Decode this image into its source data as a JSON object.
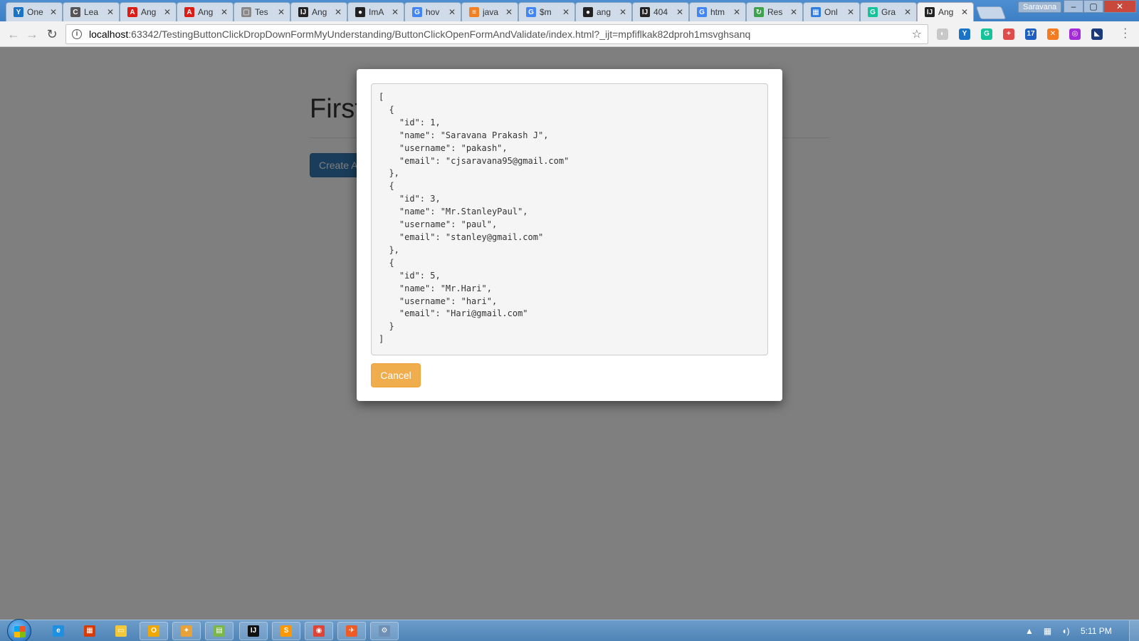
{
  "browser": {
    "tabs": [
      {
        "title": "One",
        "icon": "y-icon",
        "color": "#1a73c7",
        "glyph": "Y"
      },
      {
        "title": "Lea",
        "icon": "code-icon",
        "color": "#555555",
        "glyph": "C"
      },
      {
        "title": "Ang",
        "icon": "angular-icon",
        "color": "#dd1b16",
        "glyph": "A"
      },
      {
        "title": "Ang",
        "icon": "angular-icon",
        "color": "#dd1b16",
        "glyph": "A"
      },
      {
        "title": "Tes",
        "icon": "page-icon",
        "color": "#888888",
        "glyph": "▢"
      },
      {
        "title": "Ang",
        "icon": "intellij-icon",
        "color": "#222222",
        "glyph": "IJ"
      },
      {
        "title": "ImA",
        "icon": "github-icon",
        "color": "#222222",
        "glyph": "●"
      },
      {
        "title": "hov",
        "icon": "google-icon",
        "color": "#4285f4",
        "glyph": "G"
      },
      {
        "title": "java",
        "icon": "stackoverflow-icon",
        "color": "#f48024",
        "glyph": "≡"
      },
      {
        "title": "$m",
        "icon": "google-icon",
        "color": "#4285f4",
        "glyph": "G"
      },
      {
        "title": "ang",
        "icon": "github-icon",
        "color": "#222222",
        "glyph": "●"
      },
      {
        "title": "404",
        "icon": "intellij-icon",
        "color": "#222222",
        "glyph": "IJ"
      },
      {
        "title": "htm",
        "icon": "google-icon",
        "color": "#4285f4",
        "glyph": "G"
      },
      {
        "title": "Res",
        "icon": "refresh-icon",
        "color": "#3fa34d",
        "glyph": "↻"
      },
      {
        "title": "Onl",
        "icon": "grid-icon",
        "color": "#2f7de1",
        "glyph": "▦"
      },
      {
        "title": "Gra",
        "icon": "grammarly-icon",
        "color": "#15c39a",
        "glyph": "G"
      },
      {
        "title": "Ang",
        "icon": "intellij-icon",
        "color": "#222222",
        "glyph": "IJ",
        "active": true
      }
    ],
    "user_badge": "Saravana",
    "url_host": "localhost",
    "url_rest": ":63342/TestingButtonClickDropDownFormMyUnderstanding/ButtonClickOpenFormAndValidate/index.html?_ijt=mpfiflkak82dproh1msvghsanq",
    "extensions": [
      {
        "icon": "opera-icon",
        "color": "#c8c8c8",
        "glyph": "◐"
      },
      {
        "icon": "y-icon",
        "color": "#1a73c7",
        "glyph": "Y"
      },
      {
        "icon": "grammarly-icon",
        "color": "#15c39a",
        "glyph": "G"
      },
      {
        "icon": "plus-icon",
        "color": "#e04b4b",
        "glyph": "+"
      },
      {
        "icon": "cloud-icon",
        "color": "#1f5fbf",
        "glyph": "17"
      },
      {
        "icon": "orange-x-icon",
        "color": "#f47b20",
        "glyph": "✕"
      },
      {
        "icon": "purple-globe-icon",
        "color": "#a32bd8",
        "glyph": "◎"
      },
      {
        "icon": "bookmark-icon",
        "color": "#1a3a7a",
        "glyph": "◣"
      }
    ]
  },
  "page": {
    "heading": "First",
    "create_button": "Create A",
    "modal": {
      "json_text": "[\n  {\n    \"id\": 1,\n    \"name\": \"Saravana Prakash J\",\n    \"username\": \"pakash\",\n    \"email\": \"cjsaravana95@gmail.com\"\n  },\n  {\n    \"id\": 3,\n    \"name\": \"Mr.StanleyPaul\",\n    \"username\": \"paul\",\n    \"email\": \"stanley@gmail.com\"\n  },\n  {\n    \"id\": 5,\n    \"name\": \"Mr.Hari\",\n    \"username\": \"hari\",\n    \"email\": \"Hari@gmail.com\"\n  }\n]",
      "cancel_label": "Cancel"
    }
  },
  "taskbar": {
    "clock": "5:11 PM",
    "items": [
      {
        "icon": "ie-icon",
        "color": "#1f8fe0",
        "glyph": "e"
      },
      {
        "icon": "office-icon",
        "color": "#d83b01",
        "glyph": "▦"
      },
      {
        "icon": "explorer-icon",
        "color": "#f3c83a",
        "glyph": "▭"
      },
      {
        "icon": "outlook-icon",
        "color": "#f0a800",
        "glyph": "O"
      },
      {
        "icon": "paint-icon",
        "color": "#e8a23a",
        "glyph": "✦"
      },
      {
        "icon": "folders-icon",
        "color": "#7ab648",
        "glyph": "▤"
      },
      {
        "icon": "intellij-icon",
        "color": "#111111",
        "glyph": "IJ"
      },
      {
        "icon": "sublime-icon",
        "color": "#ff9800",
        "glyph": "S"
      },
      {
        "icon": "chrome-icon",
        "color": "#db4437",
        "glyph": "◉"
      },
      {
        "icon": "postman-icon",
        "color": "#ef5b25",
        "glyph": "✈"
      },
      {
        "icon": "tools-icon",
        "color": "#6f8fb4",
        "glyph": "⚙"
      }
    ]
  }
}
